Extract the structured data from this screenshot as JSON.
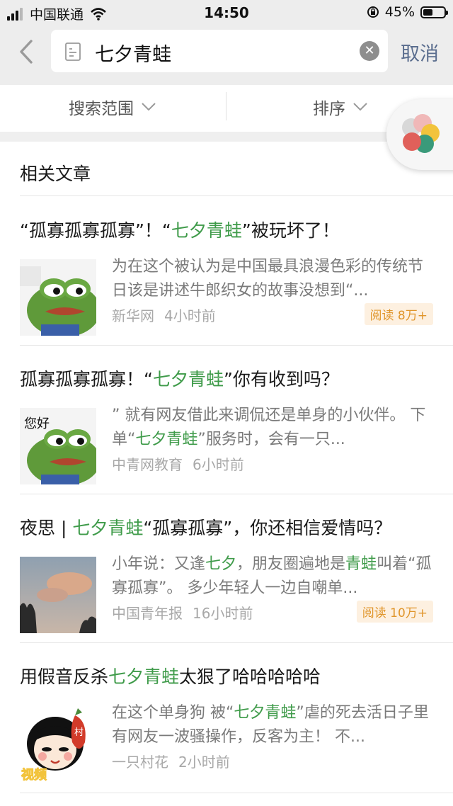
{
  "status_bar": {
    "carrier": "中国联通",
    "time": "14:50",
    "battery": "45%",
    "battery_level": 0.45
  },
  "search": {
    "back_icon": "chevron-left-icon",
    "query": "七夕青蛙",
    "clear_icon": "clear-icon",
    "cancel_label": "取消"
  },
  "filters": {
    "scope_label": "搜索范围",
    "sort_label": "排序"
  },
  "section_title": "相关文章",
  "articles": [
    {
      "title_parts": [
        "“孤寡孤寡孤寡”！“",
        "七夕青蛙",
        "”被玩坏了！"
      ],
      "snippet": "为在这个被认为是中国最具浪漫色彩的传统节日该是讲述牛郎织女的故事没想到“...",
      "source": "新华网",
      "time": "4小时前",
      "read": "阅读 8万+"
    },
    {
      "title_parts": [
        "孤寡孤寡孤寡！“",
        "七夕青蛙",
        "”你有收到吗？"
      ],
      "snippet_parts": [
        "” 就有网友借此来调侃还是单身的小伙伴。 下单“",
        "七夕青蛙",
        "”服务时，会有一只..."
      ],
      "thumb_text": "您好",
      "source": "中青网教育",
      "time": "6小时前"
    },
    {
      "title_parts": [
        "夜思 | ",
        "七夕青蛙",
        "“孤寡孤寡”，你还相信爱情吗？"
      ],
      "snippet_parts": [
        "小年说：又逢",
        "七夕",
        "，朋友圈遍地是",
        "青蛙",
        "叫着“孤寡孤寡”。 多少年轻人一边自嘲单..."
      ],
      "source": "中国青年报",
      "time": "16小时前",
      "read": "阅读 10万+"
    },
    {
      "title_parts": [
        "用假音反杀",
        "七夕青蛙",
        "太狠了哈哈哈哈哈"
      ],
      "snippet_parts": [
        "在这个单身狗 被“",
        "七夕青蛙",
        "”虐的死去活日子里 有网友一波骚操作，反客为主！ 不..."
      ],
      "thumb_text": "视频",
      "thumb_badge": "村",
      "source": "一只村花",
      "time": "2小时前"
    }
  ],
  "colors": {
    "highlight": "#3f9b4a",
    "link": "#5a6d8e",
    "read_badge": "#e0952a"
  }
}
